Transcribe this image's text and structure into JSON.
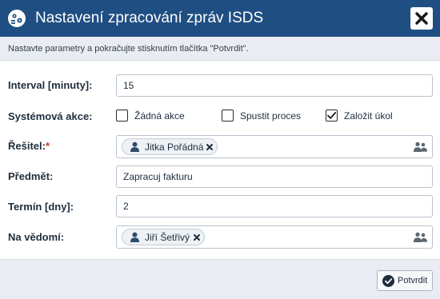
{
  "dialog": {
    "title": "Nastavení zpracování zpráv ISDS",
    "hint": "Nastavte parametry a pokračujte stisknutím tlačítka \"Potvrdit\"."
  },
  "form": {
    "interval": {
      "label": "Interval [minuty]:",
      "value": "15"
    },
    "system_action": {
      "label": "Systémová akce:",
      "options": [
        {
          "label": "Žádná akce",
          "checked": false
        },
        {
          "label": "Spustit proces",
          "checked": false
        },
        {
          "label": "Založit úkol",
          "checked": true
        }
      ]
    },
    "resolver": {
      "label": "Řešitel:",
      "required_mark": "*",
      "tags": [
        "Jitka Pořádná"
      ]
    },
    "subject": {
      "label": "Předmět:",
      "value": "Zapracuj fakturu"
    },
    "deadline": {
      "label": "Termín [dny]:",
      "value": "2"
    },
    "cc": {
      "label": "Na vědomí:",
      "tags": [
        "Jiří Šetřivý"
      ]
    }
  },
  "footer": {
    "confirm_label": "Potvrdit"
  },
  "colors": {
    "titlebar": "#1f4e82",
    "subheader": "#e9edf3",
    "required": "#d0342c",
    "icon": "#2b4c6f"
  },
  "icons": {
    "app": "process-settings-icon",
    "close": "close-icon",
    "tag_person": "person-icon",
    "tag_remove": "remove-x-icon",
    "picker": "user-group-icon",
    "confirm": "check-circle-icon"
  }
}
